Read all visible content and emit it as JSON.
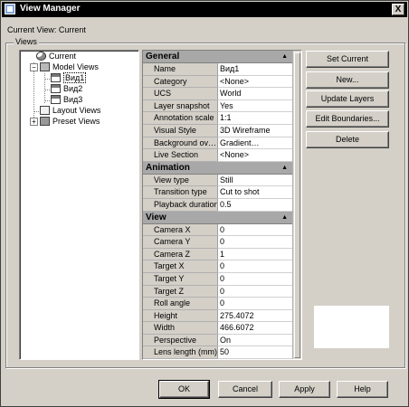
{
  "window": {
    "title": "View Manager",
    "close_label": "X"
  },
  "current_view_label": "Current View: Current",
  "views_group_label": "Views",
  "tree": {
    "current": "Current",
    "model_views": "Model Views",
    "views": [
      "Вид1",
      "Вид2",
      "Вид3"
    ],
    "layout_views": "Layout Views",
    "preset_views": "Preset Views"
  },
  "sections": {
    "general": {
      "title": "General",
      "rows": [
        {
          "name": "Name",
          "value": "Вид1"
        },
        {
          "name": "Category",
          "value": "<None>"
        },
        {
          "name": "UCS",
          "value": "World"
        },
        {
          "name": "Layer snapshot",
          "value": "Yes"
        },
        {
          "name": "Annotation scale",
          "value": "1:1"
        },
        {
          "name": "Visual Style",
          "value": "3D Wireframe"
        },
        {
          "name": "Background ov…",
          "value": "Gradient…"
        },
        {
          "name": "Live Section",
          "value": "<None>"
        }
      ]
    },
    "animation": {
      "title": "Animation",
      "rows": [
        {
          "name": "View type",
          "value": "Still"
        },
        {
          "name": "Transition type",
          "value": "Cut to shot"
        },
        {
          "name": "Playback duration",
          "value": "0.5"
        }
      ]
    },
    "view": {
      "title": "View",
      "rows": [
        {
          "name": "Camera X",
          "value": "0"
        },
        {
          "name": "Camera Y",
          "value": "0"
        },
        {
          "name": "Camera Z",
          "value": "1"
        },
        {
          "name": "Target X",
          "value": "0"
        },
        {
          "name": "Target Y",
          "value": "0"
        },
        {
          "name": "Target Z",
          "value": "0"
        },
        {
          "name": "Roll angle",
          "value": "0"
        },
        {
          "name": "Height",
          "value": "275.4072"
        },
        {
          "name": "Width",
          "value": "466.6072"
        },
        {
          "name": "Perspective",
          "value": "On"
        },
        {
          "name": "Lens length (mm)",
          "value": "50"
        }
      ]
    }
  },
  "side_buttons": {
    "set_current": "Set Current",
    "new": "New...",
    "update_layers": "Update Layers",
    "edit_boundaries": "Edit Boundaries...",
    "delete": "Delete"
  },
  "bottom_buttons": {
    "ok": "OK",
    "cancel": "Cancel",
    "apply": "Apply",
    "help": "Help"
  },
  "colors": {
    "dialog_bg": "#d4d0c8",
    "title_bg": "#000000",
    "section_bg": "#a8a8a8"
  }
}
